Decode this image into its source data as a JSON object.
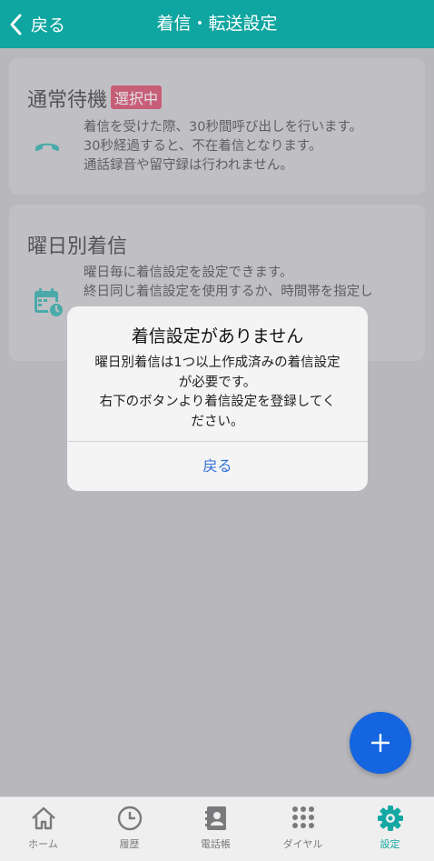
{
  "header": {
    "back_label": "戻る",
    "title": "着信・転送設定"
  },
  "cards": {
    "standby": {
      "title": "通常待機",
      "badge": "選択中",
      "lines": [
        "着信を受けた際、30秒間呼び出しを行います。",
        "30秒経過すると、不在着信となります。",
        "通話録音や留守録は行われません。"
      ]
    },
    "weekday": {
      "title": "曜日別着信",
      "lines": [
        "曜日毎に着信設定を設定できます。",
        "終日同じ着信設定を使用するか、時間帯を指定し"
      ]
    }
  },
  "dialog": {
    "title": "着信設定がありません",
    "lines": [
      "曜日別着信は1つ以上作成済みの着信設定",
      "が必要です。",
      "右下のボタンより着信設定を登録してく",
      "ださい。"
    ],
    "button_label": "戻る"
  },
  "fab": {
    "icon": "plus-icon"
  },
  "tabbar": {
    "items": [
      {
        "label": "ホーム",
        "icon": "home-icon"
      },
      {
        "label": "履歴",
        "icon": "clock-icon"
      },
      {
        "label": "電話帳",
        "icon": "contacts-book-icon"
      },
      {
        "label": "ダイヤル",
        "icon": "dialpad-icon"
      },
      {
        "label": "設定",
        "icon": "gear-icon"
      }
    ],
    "active_index": 4
  },
  "colors": {
    "header": "#0fa5a0",
    "badge": "#d53457",
    "fab": "#1565e0",
    "link": "#2f6fd9",
    "active_tab": "#14a8a3"
  }
}
